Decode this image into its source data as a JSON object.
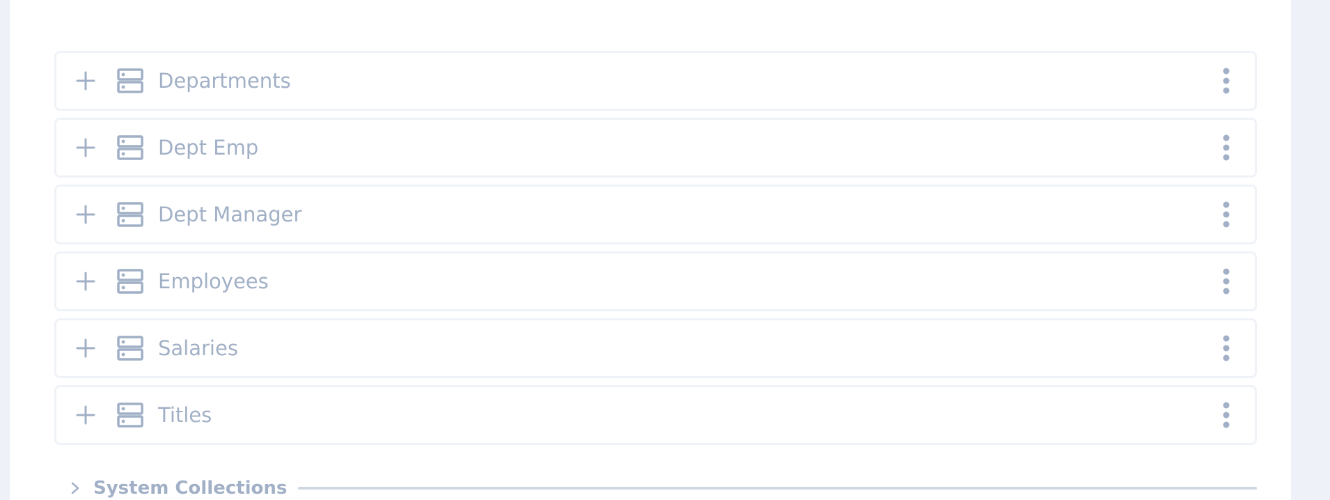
{
  "collections": [
    {
      "label": "Departments"
    },
    {
      "label": "Dept Emp"
    },
    {
      "label": "Dept Manager"
    },
    {
      "label": "Employees"
    },
    {
      "label": "Salaries"
    },
    {
      "label": "Titles"
    }
  ],
  "system": {
    "label": "System Collections"
  },
  "icons": {
    "expand": "plus-icon",
    "collection": "database-icon",
    "menu": "more-vertical-icon",
    "group_toggle": "chevron-right-icon"
  },
  "colors": {
    "text_muted": "#a1b0c6",
    "border": "#eff2f7",
    "background": "#eef1f8",
    "panel": "#ffffff"
  }
}
